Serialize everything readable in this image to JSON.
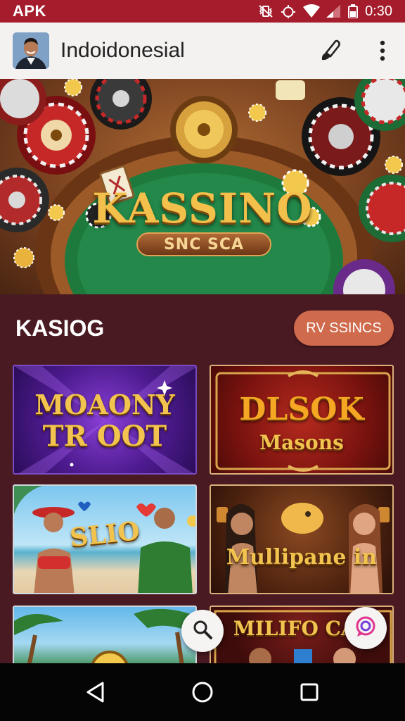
{
  "status_bar": {
    "carrier": "APK",
    "time": "0:30",
    "icons": [
      "vibrate-icon",
      "alarm-icon",
      "wifi-icon",
      "signal-icon",
      "battery-icon"
    ]
  },
  "app_bar": {
    "title": "Indoidonesial",
    "actions": [
      "brush-icon",
      "more-vert-icon"
    ]
  },
  "hero": {
    "title": "KASSINO",
    "subtitle": "SNC SCA"
  },
  "section": {
    "title": "KASIOG",
    "button_label": "RV SSINCS"
  },
  "games": [
    {
      "line1": "MOAONY",
      "line2": "TR OOT"
    },
    {
      "line1": "DLSOK",
      "line2": "Masons"
    },
    {
      "line1": "SLIO",
      "line2": ""
    },
    {
      "line1": "Mullipane in",
      "line2": ""
    },
    {
      "line1": "",
      "line2": ""
    },
    {
      "line1": "MILIFO CAL",
      "line2": ""
    }
  ],
  "floating_actions": [
    "search-icon",
    "chat-icon"
  ],
  "nav": [
    "back-icon",
    "home-icon",
    "recents-icon"
  ],
  "colors": {
    "status_bar": "#a51d2d",
    "app_bar": "#f4f2f1",
    "background": "#4a1a22",
    "accent_button": "#cf6a4c",
    "gold_text": "#f2c44f",
    "felt_green": "#1e7a3c"
  }
}
